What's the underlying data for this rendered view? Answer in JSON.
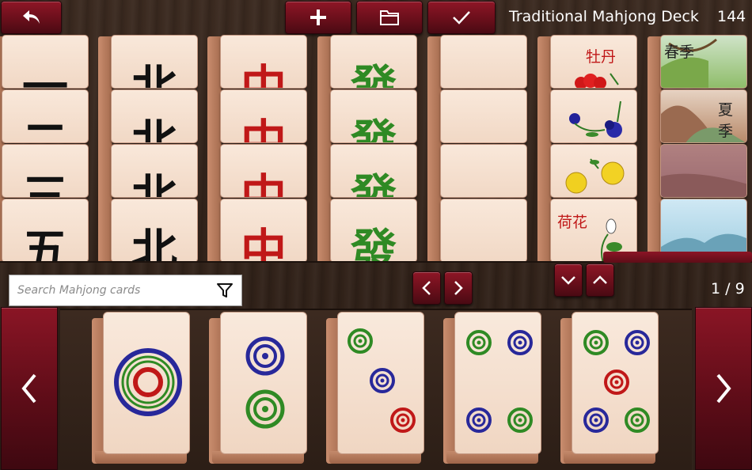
{
  "toolbar": {
    "back_icon": "back-arrow-icon",
    "add_icon": "plus-icon",
    "folder_icon": "folder-icon",
    "confirm_icon": "checkmark-icon"
  },
  "deck": {
    "title": "Traditional Mahjong Deck",
    "count": "144"
  },
  "deck_columns": [
    {
      "label": "characters-column",
      "glyph": "一",
      "color": "#111111"
    },
    {
      "label": "north-wind-column",
      "glyph": "北",
      "color": "#111111"
    },
    {
      "label": "red-dragon-column",
      "glyph": "中",
      "color": "#c01818"
    },
    {
      "label": "green-dragon-column",
      "glyph": "發",
      "color": "#2f8a24"
    },
    {
      "label": "white-dragon-column",
      "glyph": "",
      "color": "#111111"
    },
    {
      "label": "flowers-column",
      "glyph": "",
      "color": "#c01818"
    },
    {
      "label": "seasons-column",
      "glyph": "",
      "color": "#111111"
    }
  ],
  "flower_labels": [
    "牡丹",
    "荷花"
  ],
  "season_labels": [
    "春季",
    "夏季"
  ],
  "search": {
    "placeholder": "Search Mahjong cards"
  },
  "pager": {
    "indicator": "1 / 9"
  },
  "tray_tiles": [
    {
      "name": "one-circle-tile"
    },
    {
      "name": "two-circles-tile"
    },
    {
      "name": "three-circles-tile"
    },
    {
      "name": "four-circles-tile"
    },
    {
      "name": "five-circles-tile"
    }
  ],
  "colors": {
    "accent_red": "#7a1220",
    "tile_face": "#f5dfcf",
    "circle_green": "#2f8a24",
    "circle_blue": "#28289a",
    "circle_red": "#c01818"
  }
}
